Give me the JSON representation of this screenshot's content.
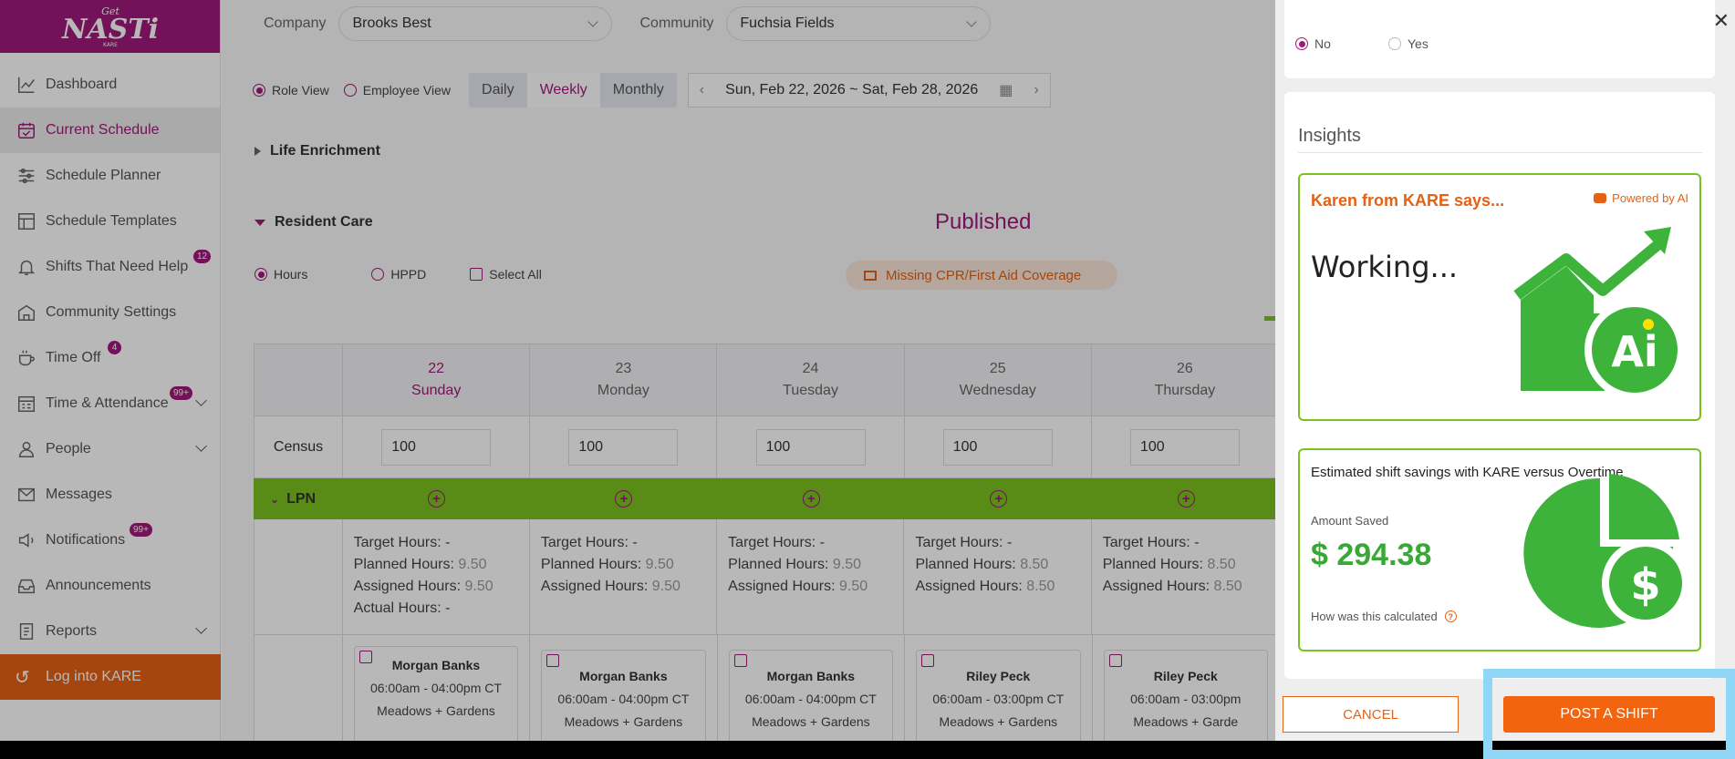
{
  "brand": {
    "logo_text": "NASTi",
    "logo_super": "Get",
    "logo_sub": "KARE",
    "accent": "#a0197a",
    "kare_orange": "#e36214",
    "green": "#7ac21f"
  },
  "sidebar": {
    "items": [
      {
        "label": "Dashboard",
        "icon": "chart-icon"
      },
      {
        "label": "Current Schedule",
        "icon": "calendar-check-icon",
        "active": true
      },
      {
        "label": "Schedule Planner",
        "icon": "sliders-icon"
      },
      {
        "label": "Schedule Templates",
        "icon": "template-icon"
      },
      {
        "label": "Shifts That Need Help",
        "icon": "bell-icon",
        "badge": "12"
      },
      {
        "label": "Community Settings",
        "icon": "building-icon"
      },
      {
        "label": "Time Off",
        "icon": "coffee-icon",
        "badge": "4"
      },
      {
        "label": "Time & Attendance",
        "icon": "timesheet-icon",
        "badge": "99+",
        "expandable": true
      },
      {
        "label": "People",
        "icon": "person-icon",
        "expandable": true
      },
      {
        "label": "Messages",
        "icon": "mail-icon"
      },
      {
        "label": "Notifications",
        "icon": "speaker-icon",
        "badge": "99+"
      },
      {
        "label": "Announcements",
        "icon": "inbox-icon"
      },
      {
        "label": "Reports",
        "icon": "report-icon",
        "expandable": true
      }
    ],
    "kare_login": "Log into KARE"
  },
  "topbar": {
    "company_label": "Company",
    "company_value": "Brooks Best",
    "community_label": "Community",
    "community_value": "Fuchsia Fields"
  },
  "view": {
    "role_view": "Role View",
    "employee_view": "Employee View",
    "periods": [
      "Daily",
      "Weekly",
      "Monthly"
    ],
    "selected_period": "Weekly",
    "date_range": "Sun, Feb 22, 2026 ~ Sat, Feb 28, 2026"
  },
  "sections": {
    "life_enrichment": "Life Enrichment",
    "resident_care": "Resident Care",
    "status": "Published",
    "hours": "Hours",
    "hppd": "HPPD",
    "select_all": "Select All",
    "missing": "Missing CPR/First Aid Coverage"
  },
  "grid": {
    "census_label": "Census",
    "role_label": "LPN",
    "days": [
      {
        "num": "22",
        "name": "Sunday",
        "census": "100",
        "target": "-",
        "planned": "9.50",
        "assigned": "9.50",
        "actual": "-",
        "shift_name": "Morgan Banks",
        "shift_time": "06:00am - 04:00pm CT",
        "shift_loc": "Meadows + Gardens"
      },
      {
        "num": "23",
        "name": "Monday",
        "census": "100",
        "target": "-",
        "planned": "9.50",
        "assigned": "9.50",
        "shift_name": "Morgan Banks",
        "shift_time": "06:00am - 04:00pm CT",
        "shift_loc": "Meadows + Gardens"
      },
      {
        "num": "24",
        "name": "Tuesday",
        "census": "100",
        "target": "-",
        "planned": "9.50",
        "assigned": "9.50",
        "shift_name": "Morgan Banks",
        "shift_time": "06:00am - 04:00pm CT",
        "shift_loc": "Meadows + Gardens"
      },
      {
        "num": "25",
        "name": "Wednesday",
        "census": "100",
        "target": "-",
        "planned": "8.50",
        "assigned": "8.50",
        "shift_name": "Riley Peck",
        "shift_time": "06:00am - 03:00pm CT",
        "shift_loc": "Meadows + Gardens"
      },
      {
        "num": "26",
        "name": "Thursday",
        "census": "100",
        "target": "-",
        "planned": "8.50",
        "assigned": "8.50",
        "shift_name": "Riley Peck",
        "shift_time": "06:00am - 03:00pm",
        "shift_loc": "Meadows + Garde"
      }
    ],
    "labels": {
      "target": "Target Hours:",
      "planned": "Planned Hours:",
      "assigned": "Assigned Hours:",
      "actual": "Actual Hours:"
    }
  },
  "panel": {
    "no": "No",
    "yes": "Yes",
    "insights_title": "Insights",
    "ai_heading": "Karen from KARE says...",
    "ai_powered": "Powered by AI",
    "ai_status": "Working...",
    "savings_title": "Estimated shift savings with KARE versus Overtime",
    "amount_label": "Amount Saved",
    "amount_value": "$ 294.38",
    "how_calc": "How was this calculated",
    "cancel": "CANCEL",
    "post": "POST A SHIFT"
  }
}
